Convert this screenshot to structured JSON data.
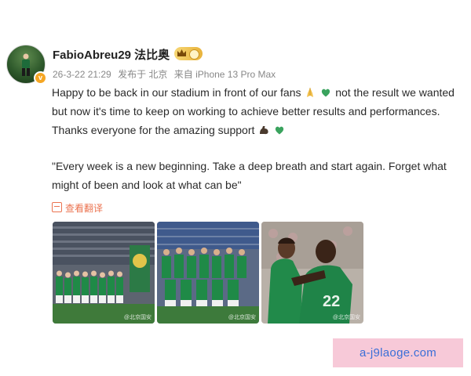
{
  "post": {
    "username": "FabioAbreu29 法比奥",
    "meta": {
      "date": "26-3-22 21:29",
      "location": "发布于 北京",
      "device": "来自 iPhone 13 Pro Max"
    },
    "paragraph1": {
      "part1": "Happy to be back in our stadium in front of our fans",
      "part2": "not the result we wanted but now it's time to keep on working to achieve better results and performances.  Thanks everyone for the amazing support"
    },
    "paragraph2": "\"Every week is a new beginning. Take a deep breath and start again. Forget what might of been and look at what can be\"",
    "translate_label": "查看翻译",
    "photos": [
      {
        "name": "team-lineup-photo",
        "watermark": "@北京国安"
      },
      {
        "name": "team-group-photo",
        "watermark": "@北京国安"
      },
      {
        "name": "celebration-photo",
        "watermark": "@北京国安"
      }
    ],
    "icons": {
      "praying-hands": "praying-hands-emoji",
      "green-heart": "green-heart-emoji",
      "flexed-biceps": "flexed-biceps-emoji",
      "verified": "verified-badge-icon",
      "vip": "vip-crown-badge-icon"
    },
    "colors": {
      "accent": "#eb7350",
      "green": "#2c8a4a",
      "muted": "#888888"
    }
  },
  "watermark_site": "a-j9laoge.com"
}
